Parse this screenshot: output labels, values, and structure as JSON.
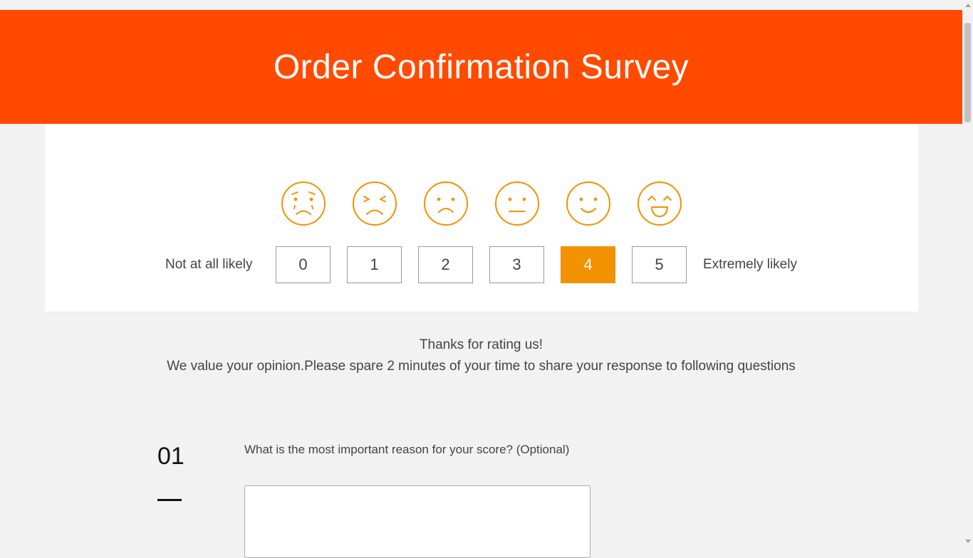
{
  "header": {
    "title": "Order Confirmation Survey",
    "bg_color": "#ff4a00"
  },
  "rating": {
    "left_label": "Not at all likely",
    "right_label": "Extremely likely",
    "options": [
      "0",
      "1",
      "2",
      "3",
      "4",
      "5"
    ],
    "selected": "4",
    "accent_color": "#f29200",
    "face_icons": [
      "crying-face-icon",
      "squinting-sad-face-icon",
      "sad-face-icon",
      "neutral-face-icon",
      "smiling-face-icon",
      "laughing-face-icon"
    ]
  },
  "thanks": {
    "line1": "Thanks for rating us!",
    "line2": "We value your opinion.Please spare 2 minutes of your time to share your response to following questions"
  },
  "question": {
    "number": "01",
    "text": "What is the most important reason for your score? (Optional)",
    "answer_value": ""
  }
}
